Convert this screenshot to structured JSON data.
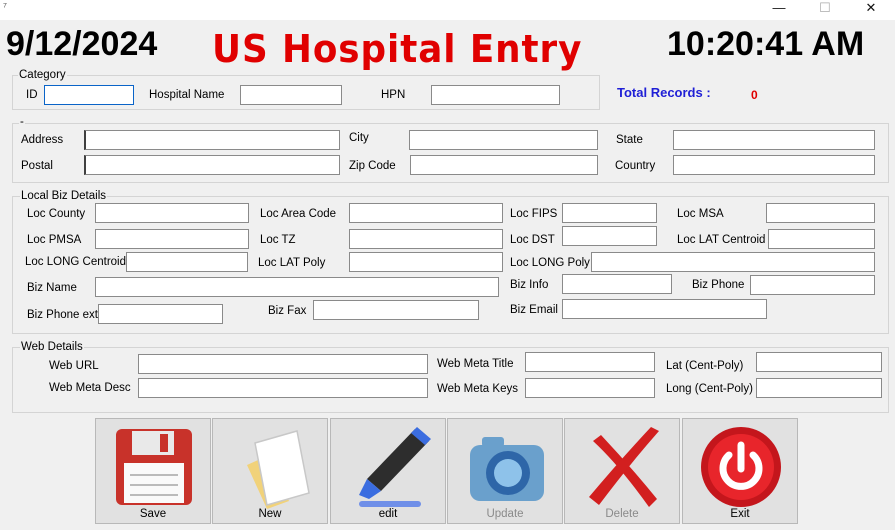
{
  "window": {
    "title_icon": "form-icon",
    "min_glyph": "—",
    "max_glyph": "☐",
    "close_glyph": "✕"
  },
  "header": {
    "date": "9/12/2024",
    "title": "US Hospital Entry",
    "time": "10:20:41 AM"
  },
  "category": {
    "legend": "Category",
    "id_label": "ID",
    "id_value": "",
    "hospital_name_label": "Hospital Name",
    "hospital_name_value": "",
    "hpn_label": "HPN",
    "hpn_value": ""
  },
  "totals": {
    "label": "Total Records :",
    "value": "0"
  },
  "address_group": {
    "legend": "-",
    "address_label": "Address",
    "address_value": "",
    "city_label": "City",
    "city_value": "",
    "state_label": "State",
    "state_value": "",
    "postal_label": "Postal",
    "postal_value": "",
    "zip_label": "Zip Code",
    "zip_value": "",
    "country_label": "Country",
    "country_value": ""
  },
  "local_biz": {
    "legend": "Local  Biz Details",
    "loc_county": "Loc County",
    "loc_area_code": "Loc Area Code",
    "loc_fips": "Loc FIPS",
    "loc_msa": "Loc MSA",
    "loc_pmsa": "Loc PMSA",
    "loc_tz": "Loc TZ",
    "loc_dst": "Loc DST",
    "loc_lat_centroid": "Loc LAT Centroid",
    "loc_long_centroid": "Loc LONG Centroid",
    "loc_lat_poly": "Loc LAT Poly",
    "loc_long_poly": "Loc LONG Poly",
    "biz_name": "Biz Name",
    "biz_info": "Biz Info",
    "biz_phone": "Biz Phone",
    "biz_phone_ext": "Biz Phone ext",
    "biz_fax": "Biz Fax",
    "biz_email": "Biz Email"
  },
  "web": {
    "legend": "Web Details",
    "web_url": "Web URL",
    "web_meta_title": "Web Meta Title",
    "lat_cent_poly": "Lat (Cent-Poly)",
    "web_meta_desc": "Web Meta Desc",
    "web_meta_keys": "Web Meta Keys",
    "long_cent_poly": "Long (Cent-Poly)"
  },
  "toolbar": {
    "save": "Save",
    "new": "New",
    "edit": "edit",
    "update": "Update",
    "delete": "Delete",
    "exit": "Exit"
  },
  "icons": {
    "save": "floppy-disk-icon",
    "new": "new-document-icon",
    "edit": "marker-pen-icon",
    "update": "camera-globe-icon",
    "delete": "red-x-icon",
    "exit": "power-button-icon"
  },
  "colors": {
    "title_red": "#e00000",
    "total_blue": "#1f1fd6",
    "focus_blue": "#0a64c8"
  }
}
